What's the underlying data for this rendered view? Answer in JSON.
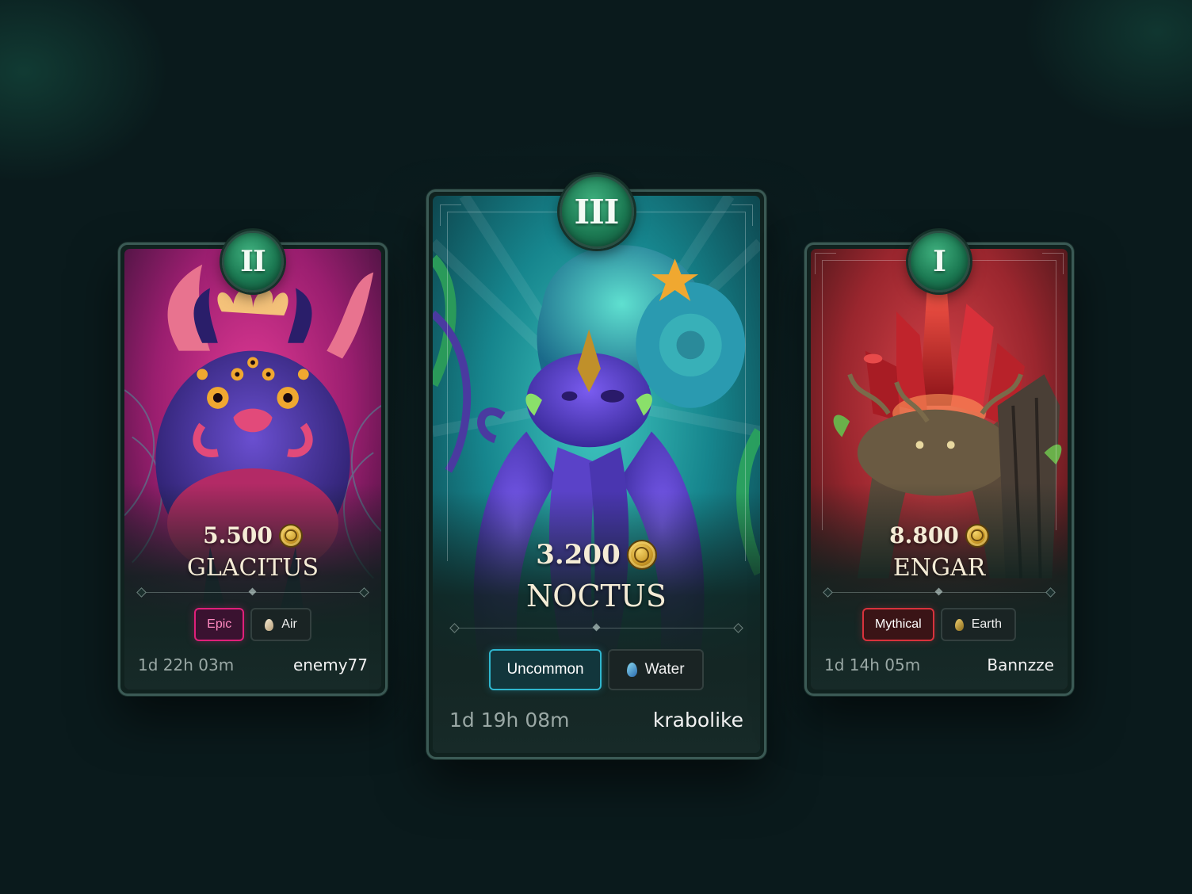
{
  "cards": [
    {
      "rank": "II",
      "price": "5.500",
      "name": "GLACITUS",
      "rarity": "Epic",
      "element": "Air",
      "timer": "1d 22h 03m",
      "owner": "enemy77",
      "colors": {
        "rarity": "#e0207a",
        "rarity_text": "#ff8ac0",
        "background": "#b8237a"
      }
    },
    {
      "rank": "III",
      "price": "3.200",
      "name": "NOCTUS",
      "rarity": "Uncommon",
      "element": "Water",
      "timer": "1d 19h 08m",
      "owner": "krabolike",
      "colors": {
        "rarity": "#2fb7cf",
        "rarity_text": "#ffffff",
        "background": "#1b8c9a"
      }
    },
    {
      "rank": "I",
      "price": "8.800",
      "name": "ENGAR",
      "rarity": "Mythical",
      "element": "Earth",
      "timer": "1d 14h 05m",
      "owner": "Bannzze",
      "colors": {
        "rarity": "#d8323c",
        "rarity_text": "#ffffff",
        "background": "#a42a32"
      }
    }
  ],
  "icons": {
    "currency": "gold-coin-icon",
    "air": "air-crystal-icon",
    "water": "water-crystal-icon",
    "earth": "earth-crystal-icon"
  }
}
